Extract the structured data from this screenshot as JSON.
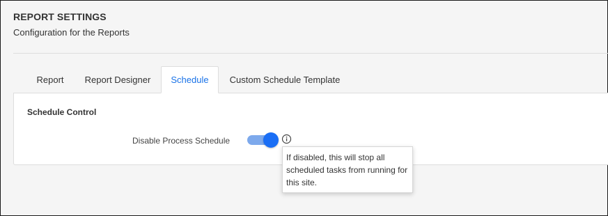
{
  "header": {
    "title": "REPORT SETTINGS",
    "subtitle": "Configuration for the Reports"
  },
  "tabs": [
    {
      "label": "Report",
      "active": false
    },
    {
      "label": "Report Designer",
      "active": false
    },
    {
      "label": "Schedule",
      "active": true
    },
    {
      "label": "Custom Schedule Template",
      "active": false
    }
  ],
  "schedule_panel": {
    "section_title": "Schedule Control",
    "disable_process_schedule": {
      "label": "Disable Process Schedule",
      "enabled": true,
      "info_icon": "info-circle-icon",
      "tooltip": "If disabled, this will stop all scheduled tasks from running for this site."
    }
  },
  "colors": {
    "accent": "#1a73e8",
    "toggle_thumb": "#1a6ef5",
    "toggle_track": "#7da9ec",
    "background": "#f5f5f5",
    "panel": "#ffffff"
  }
}
